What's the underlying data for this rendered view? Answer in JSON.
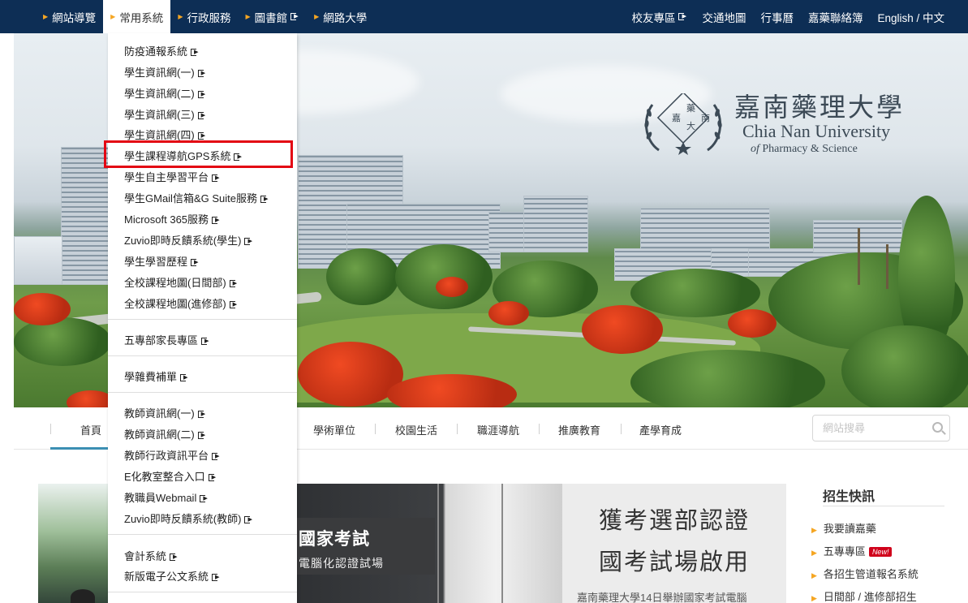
{
  "topbar": {
    "left_items": [
      {
        "label": "網站導覽",
        "external": false,
        "active": false
      },
      {
        "label": "常用系統",
        "external": false,
        "active": true
      },
      {
        "label": "行政服務",
        "external": false,
        "active": false
      },
      {
        "label": "圖書館",
        "external": true,
        "active": false
      },
      {
        "label": "網路大學",
        "external": false,
        "active": false
      }
    ],
    "right_items": [
      {
        "label": "校友專區",
        "external": true
      },
      {
        "label": "交通地圖",
        "external": false
      },
      {
        "label": "行事曆",
        "external": false
      },
      {
        "label": "嘉藥聯絡簿",
        "external": false
      },
      {
        "label": "English / 中文",
        "external": false
      }
    ]
  },
  "dropdown": {
    "items": [
      "防疫通報系統",
      "學生資訊網(一)",
      "學生資訊網(二)",
      "學生資訊網(三)",
      "學生資訊網(四)",
      "學生課程導航GPS系統",
      "學生自主學習平台",
      "學生GMail信箱&G Suite服務",
      "Microsoft 365服務",
      "Zuvio即時反饋系統(學生)",
      "學生學習歷程",
      "全校課程地圖(日間部)",
      "全校課程地圖(進修部)",
      "五專部家長專區",
      "學雜費補單",
      "教師資訊網(一)",
      "教師資訊網(二)",
      "教師行政資訊平台",
      "E化教室整合入口",
      "教職員Webmail",
      "Zuvio即時反饋系統(教師)",
      "會計系統",
      "新版電子公文系統"
    ],
    "highlighted": "學生課程導航GPS系統"
  },
  "logo": {
    "seal_chars": [
      "嘉",
      "藥",
      "南",
      "大"
    ],
    "name_cn": "嘉南藥理大學",
    "name_en_line1": "Chia Nan University",
    "name_en_of": "of",
    "name_en_line2": "Pharmacy & Science"
  },
  "subnav": {
    "items": [
      "首頁",
      "學術單位",
      "校園生活",
      "職涯導航",
      "推廣教育",
      "產學育成"
    ],
    "search_placeholder": "網站搜尋"
  },
  "news": {
    "image_text_1": "國家考試",
    "image_text_2": "電腦化認證試場",
    "headline_1": "獲考選部認證",
    "headline_2": "國考試場啟用",
    "desc": "嘉南藥理大學14日舉辦國家考試電腦"
  },
  "enroll": {
    "title": "招生快訊",
    "items": [
      "我要讀嘉藥",
      "五專專區",
      "各招生管道報名系統",
      "日間部 / 進修部招生"
    ],
    "new_badge": "New!"
  },
  "colors": {
    "topbar_bg": "#0d2e55",
    "accent_orange": "#f5a623",
    "highlight_red": "#e30613",
    "active_underline": "#3c8fb3"
  }
}
